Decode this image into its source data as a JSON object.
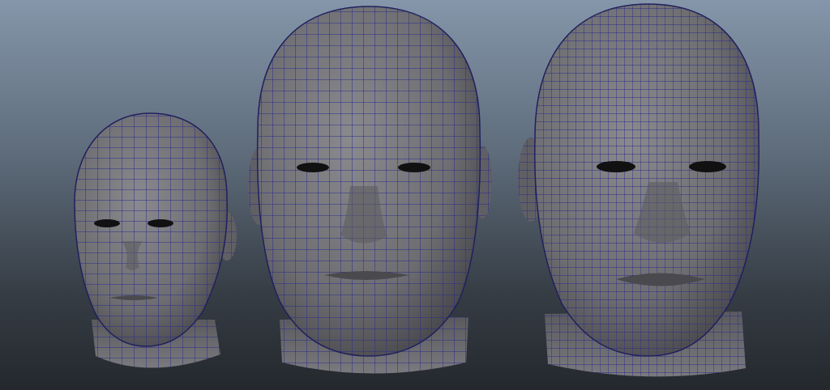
{
  "viewport": {
    "background_top": "#8596aa",
    "background_bottom": "#24282d"
  },
  "models": [
    {
      "id": "head-low",
      "subdivision": "low"
    },
    {
      "id": "head-medium",
      "subdivision": "medium"
    },
    {
      "id": "head-high",
      "subdivision": "high"
    }
  ],
  "colors": {
    "surface": "#767679",
    "wireframe": "#2a2a8c"
  }
}
